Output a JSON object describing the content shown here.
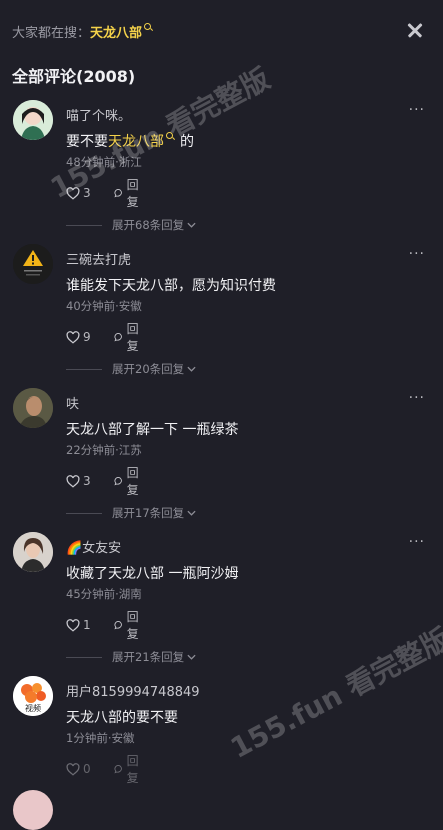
{
  "header": {
    "search_prefix": "大家都在搜：",
    "search_term": "天龙八部",
    "comment_count_title": "全部评论(2008)"
  },
  "comments": [
    {
      "username": "喵了个咪。",
      "text_before": "要不要",
      "text_highlight": "天龙八部",
      "text_after": "的",
      "meta": "48分钟前·浙江",
      "likes": "3",
      "reply_label": "回复",
      "expand_label": "展开68条回复"
    },
    {
      "username": "三碗去打虎",
      "text": "谁能发下天龙八部，愿为知识付费",
      "meta": "40分钟前·安徽",
      "likes": "9",
      "reply_label": "回复",
      "expand_label": "展开20条回复"
    },
    {
      "username": "呋",
      "text": "天龙八部了解一下 一瓶绿茶",
      "meta": "22分钟前·江苏",
      "likes": "3",
      "reply_label": "回复",
      "expand_label": "展开17条回复"
    },
    {
      "username": "🌈女友安",
      "text": "收藏了天龙八部 一瓶阿沙姆",
      "meta": "45分钟前·湖南",
      "likes": "1",
      "reply_label": "回复",
      "expand_label": "展开21条回复"
    },
    {
      "username": "用户8159994748849",
      "text": "天龙八部的要不要",
      "meta": "1分钟前·安徽",
      "likes": "0",
      "reply_label": "回复",
      "avatar_label": "视频"
    }
  ],
  "more_label": "···",
  "watermark": "155.fun 看完整版",
  "colors": {
    "background": "#1f1f28",
    "highlight": "#f4d24a"
  }
}
